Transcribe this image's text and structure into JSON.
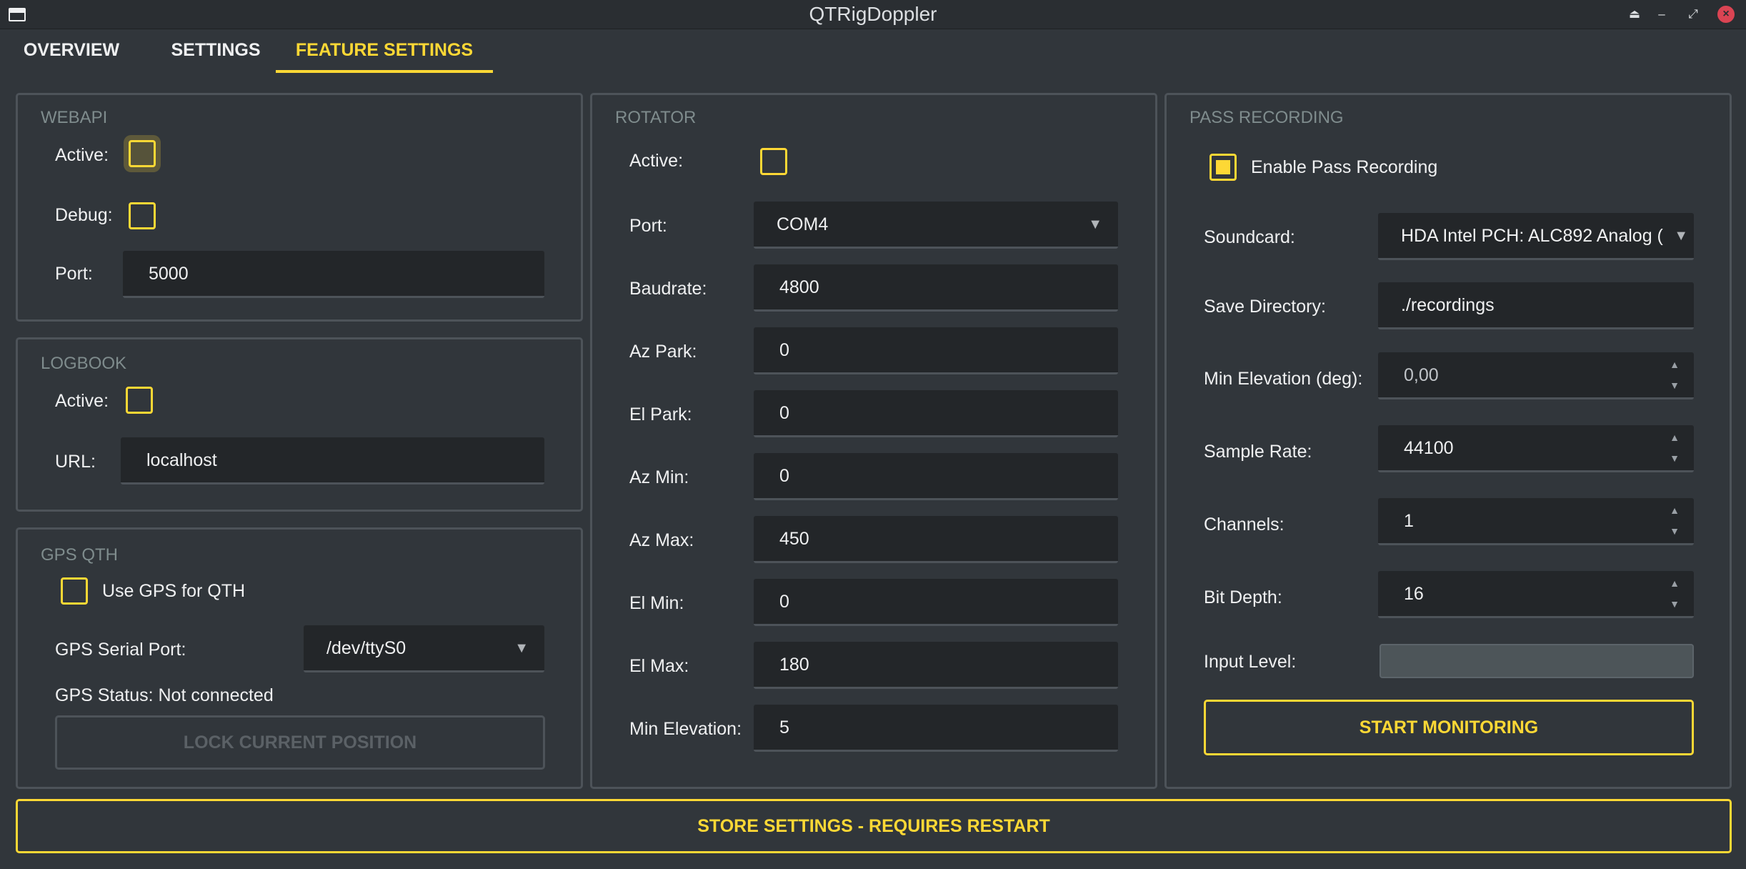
{
  "window": {
    "title": "QTRigDoppler"
  },
  "tabs": [
    {
      "label": "OVERVIEW"
    },
    {
      "label": "SETTINGS"
    },
    {
      "label": "FEATURE SETTINGS"
    }
  ],
  "webapi": {
    "title": "WEBAPI",
    "active_label": "Active:",
    "debug_label": "Debug:",
    "port_label": "Port:",
    "port_value": "5000"
  },
  "logbook": {
    "title": "LOGBOOK",
    "active_label": "Active:",
    "url_label": "URL:",
    "url_value": "localhost"
  },
  "gps": {
    "title": "GPS QTH",
    "use_gps_label": "Use GPS for QTH",
    "serial_port_label": "GPS Serial Port:",
    "serial_port_value": "/dev/ttyS0",
    "status_text": "GPS Status: Not connected",
    "lock_button": "LOCK CURRENT POSITION"
  },
  "rotator": {
    "title": "ROTATOR",
    "active_label": "Active:",
    "rows": [
      {
        "label": "Port:",
        "value": "COM4"
      },
      {
        "label": "Baudrate:",
        "value": "4800"
      },
      {
        "label": "Az Park:",
        "value": "0"
      },
      {
        "label": "El Park:",
        "value": "0"
      },
      {
        "label": "Az Min:",
        "value": "0"
      },
      {
        "label": "Az Max:",
        "value": "450"
      },
      {
        "label": "El Min:",
        "value": "0"
      },
      {
        "label": "El Max:",
        "value": "180"
      },
      {
        "label": "Min Elevation:",
        "value": "5"
      }
    ]
  },
  "pass_recording": {
    "title": "PASS RECORDING",
    "enable_label": "Enable Pass Recording",
    "enabled": true,
    "soundcard_label": "Soundcard:",
    "soundcard_value": "HDA Intel PCH: ALC892 Analog (",
    "save_dir_label": "Save Directory:",
    "save_dir_value": "./recordings",
    "min_elev_label": "Min Elevation (deg):",
    "min_elev_value": "0,00",
    "sample_rate_label": "Sample Rate:",
    "sample_rate_value": "44100",
    "channels_label": "Channels:",
    "channels_value": "1",
    "bit_depth_label": "Bit Depth:",
    "bit_depth_value": "16",
    "input_level_label": "Input Level:",
    "input_level": 0,
    "start_button": "START MONITORING"
  },
  "store_button": "STORE SETTINGS - REQUIRES RESTART",
  "colors": {
    "accent": "#fdd835",
    "background": "#31363b",
    "field_bg": "#232629",
    "border": "#4d5359"
  }
}
